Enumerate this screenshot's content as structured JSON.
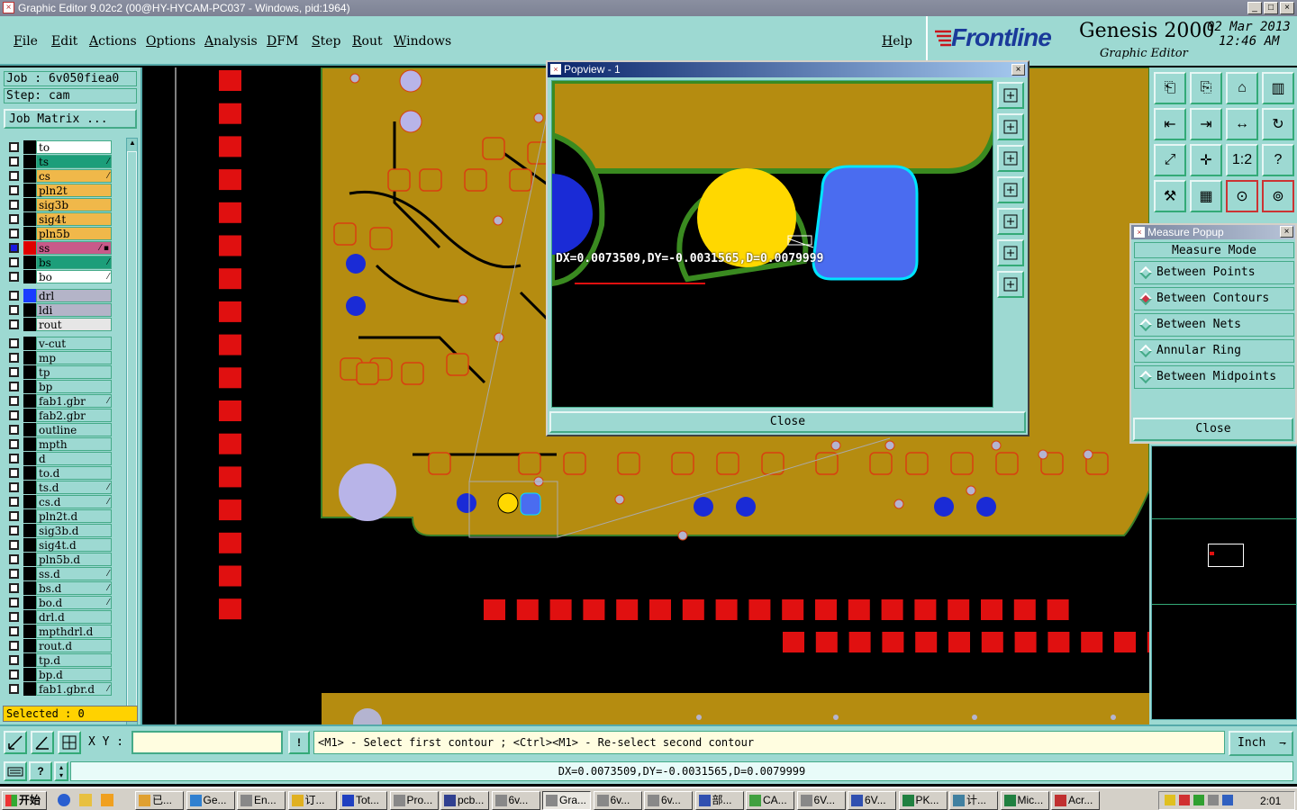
{
  "window": {
    "title": "Graphic Editor 9.02c2 (00@HY-HYCAM-PC037 - Windows, pid:1964)",
    "min": "_",
    "max": "□",
    "close": "×"
  },
  "menu": [
    "File",
    "Edit",
    "Actions",
    "Options",
    "Analysis",
    "DFM",
    "Step",
    "Rout",
    "Windows"
  ],
  "help": "Help",
  "brand": {
    "logo": "Frontline",
    "product": "Genesis 2000",
    "sub": "Graphic Editor",
    "date": "02 Mar 2013",
    "time": "12:46 AM"
  },
  "job": {
    "job_line": "Job : 6v050fiea0",
    "step_line": "Step: cam",
    "matrix_button": "Job Matrix ..."
  },
  "layers": [
    {
      "name": "to",
      "color": "#ffffff",
      "sw": "#000000",
      "mark": ""
    },
    {
      "name": "ts",
      "color": "#1c9e7a",
      "sw": "#000000",
      "mark": "⁄"
    },
    {
      "name": "cs",
      "color": "#f0b84a",
      "sw": "#000000",
      "mark": "⁄"
    },
    {
      "name": "pln2t",
      "color": "#f0b84a",
      "sw": "#000000",
      "mark": ""
    },
    {
      "name": "sig3b",
      "color": "#f0b84a",
      "sw": "#000000",
      "mark": ""
    },
    {
      "name": "sig4t",
      "color": "#f0b84a",
      "sw": "#000000",
      "mark": ""
    },
    {
      "name": "pln5b",
      "color": "#f0b84a",
      "sw": "#000000",
      "mark": ""
    },
    {
      "name": "ss",
      "color": "#c85a8a",
      "sw": "#e00000",
      "mark": "⁄ ▪"
    },
    {
      "name": "bs",
      "color": "#1c9e7a",
      "sw": "#000000",
      "mark": "⁄"
    },
    {
      "name": "bo",
      "color": "#ffffff",
      "sw": "#000000",
      "mark": "⁄"
    }
  ],
  "layers2": [
    {
      "name": "drl",
      "color": "#b4b4c8",
      "sw": "#1a3cff",
      "mark": ""
    },
    {
      "name": "ldi",
      "color": "#b4b4c8",
      "sw": "#000000",
      "mark": ""
    },
    {
      "name": "rout",
      "color": "#e6e6e6",
      "sw": "#000000",
      "mark": ""
    }
  ],
  "layers3": [
    {
      "name": "v-cut",
      "mark": ""
    },
    {
      "name": "mp",
      "mark": ""
    },
    {
      "name": "tp",
      "mark": ""
    },
    {
      "name": "bp",
      "mark": ""
    },
    {
      "name": "fab1.gbr",
      "mark": "⁄"
    },
    {
      "name": "fab2.gbr",
      "mark": ""
    },
    {
      "name": "outline",
      "mark": ""
    },
    {
      "name": "mpth",
      "mark": ""
    },
    {
      "name": "d",
      "mark": ""
    },
    {
      "name": "to.d",
      "mark": ""
    },
    {
      "name": "ts.d",
      "mark": "⁄"
    },
    {
      "name": "cs.d",
      "mark": "⁄"
    },
    {
      "name": "pln2t.d",
      "mark": ""
    },
    {
      "name": "sig3b.d",
      "mark": ""
    },
    {
      "name": "sig4t.d",
      "mark": ""
    },
    {
      "name": "pln5b.d",
      "mark": ""
    },
    {
      "name": "ss.d",
      "mark": "⁄"
    },
    {
      "name": "bs.d",
      "mark": "⁄"
    },
    {
      "name": "bo.d",
      "mark": "⁄"
    },
    {
      "name": "drl.d",
      "mark": ""
    },
    {
      "name": "mpthdrl.d",
      "mark": ""
    },
    {
      "name": "rout.d",
      "mark": ""
    },
    {
      "name": "tp.d",
      "mark": ""
    },
    {
      "name": "bp.d",
      "mark": ""
    },
    {
      "name": "fab1.gbr.d",
      "mark": "⁄"
    }
  ],
  "selected": "Selected : 0",
  "popview": {
    "title": "Popview - 1",
    "measure_text": "DX=0.0073509,DY=-0.0031565,D=0.0079999",
    "close": "Close"
  },
  "measure_popup": {
    "title": "Measure Popup",
    "heading": "Measure Mode",
    "options": [
      "Between Points",
      "Between Contours",
      "Between Nets",
      "Annular Ring",
      "Between Midpoints"
    ],
    "selected": "Between Contours",
    "close": "Close"
  },
  "command": {
    "xy_label": "X Y :",
    "xy_value": "",
    "prompt": "<M1> - Select first contour ; <Ctrl><M1> - Re-select second contour",
    "units": "Inch"
  },
  "status": {
    "text": "DX=0.0073509,DY=-0.0031565,D=0.0079999"
  },
  "taskbar": {
    "start": "开始",
    "clock": "2:01",
    "tasks": [
      "已...",
      "Ge...",
      "En...",
      "订...",
      "Tot...",
      "Pro...",
      "pcb...",
      "6v...",
      "Gra...",
      "6v...",
      "6v...",
      "部...",
      "CA...",
      "6V...",
      "6V...",
      "PK...",
      "计...",
      "Mic...",
      "Acr..."
    ]
  },
  "colors": {
    "panel": "#9dd9d2",
    "copper": "#b58c10",
    "pad_red": "#e01010",
    "drill_blue": "#1a2bd6",
    "highlight_yellow": "#ffd800"
  }
}
